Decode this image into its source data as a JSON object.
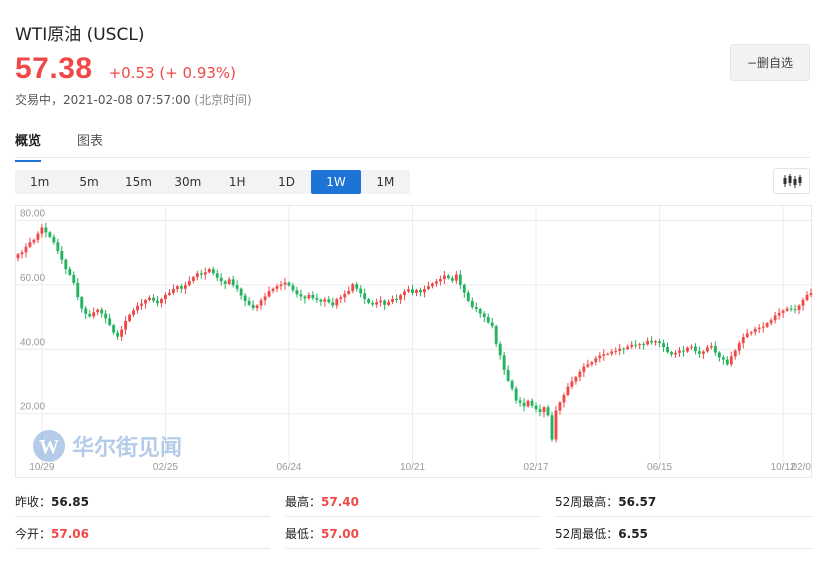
{
  "header": {
    "title": "WTI原油 (USCL)",
    "price": "57.38",
    "change": "+0.53 (+ 0.93%)",
    "status": "交易中，2021-02-08 07:57:00",
    "timezone": "(北京时间)",
    "remove_label": "−删自选"
  },
  "tabs": [
    {
      "label": "概览",
      "active": true
    },
    {
      "label": "图表",
      "active": false
    }
  ],
  "periods": [
    "1m",
    "5m",
    "15m",
    "30m",
    "1H",
    "1D",
    "1W",
    "1M"
  ],
  "active_period": "1W",
  "colors": {
    "up": "#f04848",
    "down": "#22b35e",
    "accent": "#1e73d6",
    "grid": "#ececec"
  },
  "watermark": {
    "text": "华尔街见闻",
    "logo": "W"
  },
  "stats": {
    "prev_close_label": "昨收：",
    "prev_close": "56.85",
    "open_label": "今开：",
    "open": "57.06",
    "high_label": "最高：",
    "high": "57.40",
    "low_label": "最低：",
    "low": "57.00",
    "w52_high_label": "52周最高：",
    "w52_high": "56.57",
    "w52_low_label": "52周最低：",
    "w52_low": "6.55"
  },
  "chart_data": {
    "type": "candlestick",
    "y_ticks": [
      "80.00",
      "60.00",
      "40.00",
      "20.00"
    ],
    "y_tick_values": [
      80,
      60,
      40,
      20
    ],
    "ylim": [
      5,
      82
    ],
    "x_tick_labels": [
      "10/29",
      "02/25",
      "06/24",
      "10/21",
      "02/17",
      "06/15",
      "10/12",
      "02/0"
    ],
    "x_tick_index": [
      6,
      37,
      68,
      99,
      130,
      161,
      192,
      225
    ],
    "closes": [
      69.5,
      70.1,
      71.8,
      73.2,
      74.0,
      75.9,
      77.8,
      76.3,
      74.9,
      73.2,
      70.5,
      67.8,
      64.9,
      63.1,
      60.6,
      56.2,
      52.7,
      51.0,
      50.2,
      51.5,
      52.3,
      51.1,
      49.6,
      47.5,
      45.2,
      43.9,
      46.1,
      48.8,
      50.7,
      52.1,
      53.5,
      54.2,
      55.3,
      56.0,
      55.1,
      54.3,
      55.6,
      56.9,
      57.5,
      58.7,
      59.6,
      58.8,
      59.9,
      61.2,
      62.4,
      63.6,
      63.2,
      63.9,
      64.9,
      63.6,
      62.2,
      61.1,
      60.3,
      61.7,
      59.9,
      58.8,
      56.7,
      55.0,
      53.8,
      52.8,
      53.6,
      55.2,
      56.4,
      58.1,
      58.8,
      59.6,
      60.1,
      60.7,
      59.8,
      58.3,
      57.1,
      56.4,
      55.8,
      56.9,
      55.9,
      55.4,
      54.8,
      55.5,
      54.6,
      53.6,
      55.6,
      56.1,
      57.2,
      58.1,
      60.2,
      58.8,
      57.4,
      55.6,
      54.4,
      53.9,
      54.6,
      55.1,
      53.8,
      54.7,
      55.6,
      55.4,
      56.8,
      57.9,
      58.6,
      57.5,
      58.4,
      57.7,
      58.7,
      59.6,
      60.4,
      61.1,
      61.8,
      62.9,
      62.1,
      61.3,
      63.2,
      60.0,
      57.6,
      55.0,
      53.1,
      52.5,
      51.1,
      50.0,
      48.3,
      47.2,
      41.7,
      38.1,
      33.6,
      30.2,
      27.8,
      24.1,
      23.4,
      22.3,
      24.0,
      22.5,
      21.4,
      20.5,
      22.0,
      19.5,
      12.0,
      21.0,
      23.5,
      25.8,
      28.4,
      30.0,
      31.4,
      33.0,
      34.6,
      35.3,
      36.0,
      37.2,
      38.0,
      38.5,
      38.6,
      39.3,
      39.5,
      40.2,
      40.1,
      40.8,
      41.4,
      41.3,
      41.6,
      41.5,
      42.6,
      42.1,
      42.5,
      41.9,
      40.7,
      39.1,
      38.4,
      38.9,
      39.6,
      39.3,
      40.5,
      40.8,
      39.4,
      38.6,
      39.3,
      40.6,
      41.0,
      39.0,
      37.5,
      36.8,
      35.3,
      37.8,
      39.6,
      41.9,
      43.8,
      44.9,
      45.3,
      46.3,
      46.7,
      47.0,
      48.1,
      49.0,
      50.5,
      51.3,
      52.0,
      52.6,
      52.4,
      52.2,
      53.6,
      55.3,
      56.9,
      57.4
    ],
    "up_color": "#f04848",
    "down_color": "#22b35e"
  }
}
